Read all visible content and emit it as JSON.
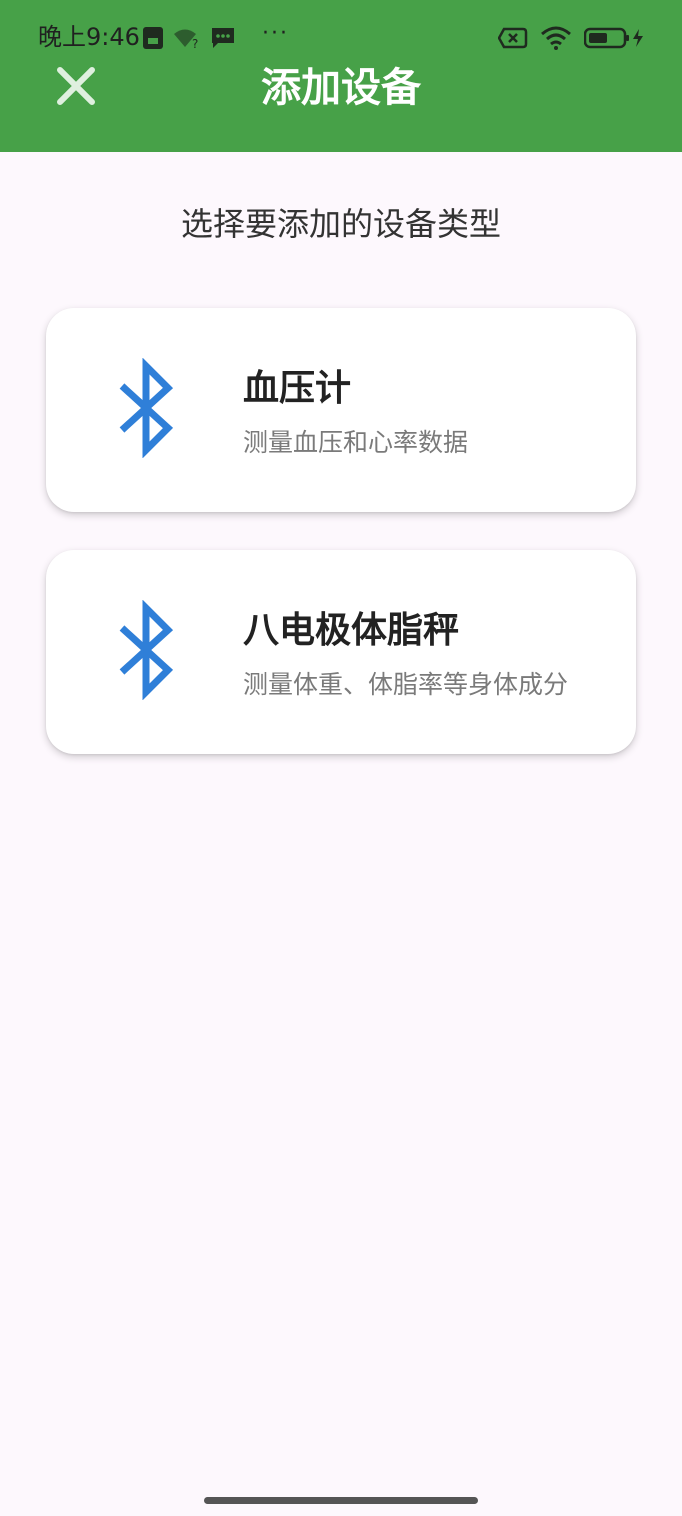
{
  "status_bar": {
    "time": "晚上9:46",
    "icons_left": [
      "sim-card-icon",
      "wifi-question-icon",
      "message-icon",
      "more-dots-icon"
    ],
    "overflow_dots": "···",
    "icons_right": [
      "no-sim-icon",
      "wifi-icon",
      "battery-charging-icon"
    ]
  },
  "header": {
    "title": "添加设备",
    "close_icon": "close-icon",
    "background": "#47a148"
  },
  "main": {
    "subtitle": "选择要添加的设备类型",
    "devices": [
      {
        "icon": "bluetooth-icon",
        "title": "血压计",
        "description": "测量血压和心率数据"
      },
      {
        "icon": "bluetooth-icon",
        "title": "八电极体脂秤",
        "description": "测量体重、体脂率等身体成分"
      }
    ]
  },
  "colors": {
    "accent": "#47a148",
    "bluetooth": "#2f7fd8",
    "background": "#fdf8fd"
  }
}
